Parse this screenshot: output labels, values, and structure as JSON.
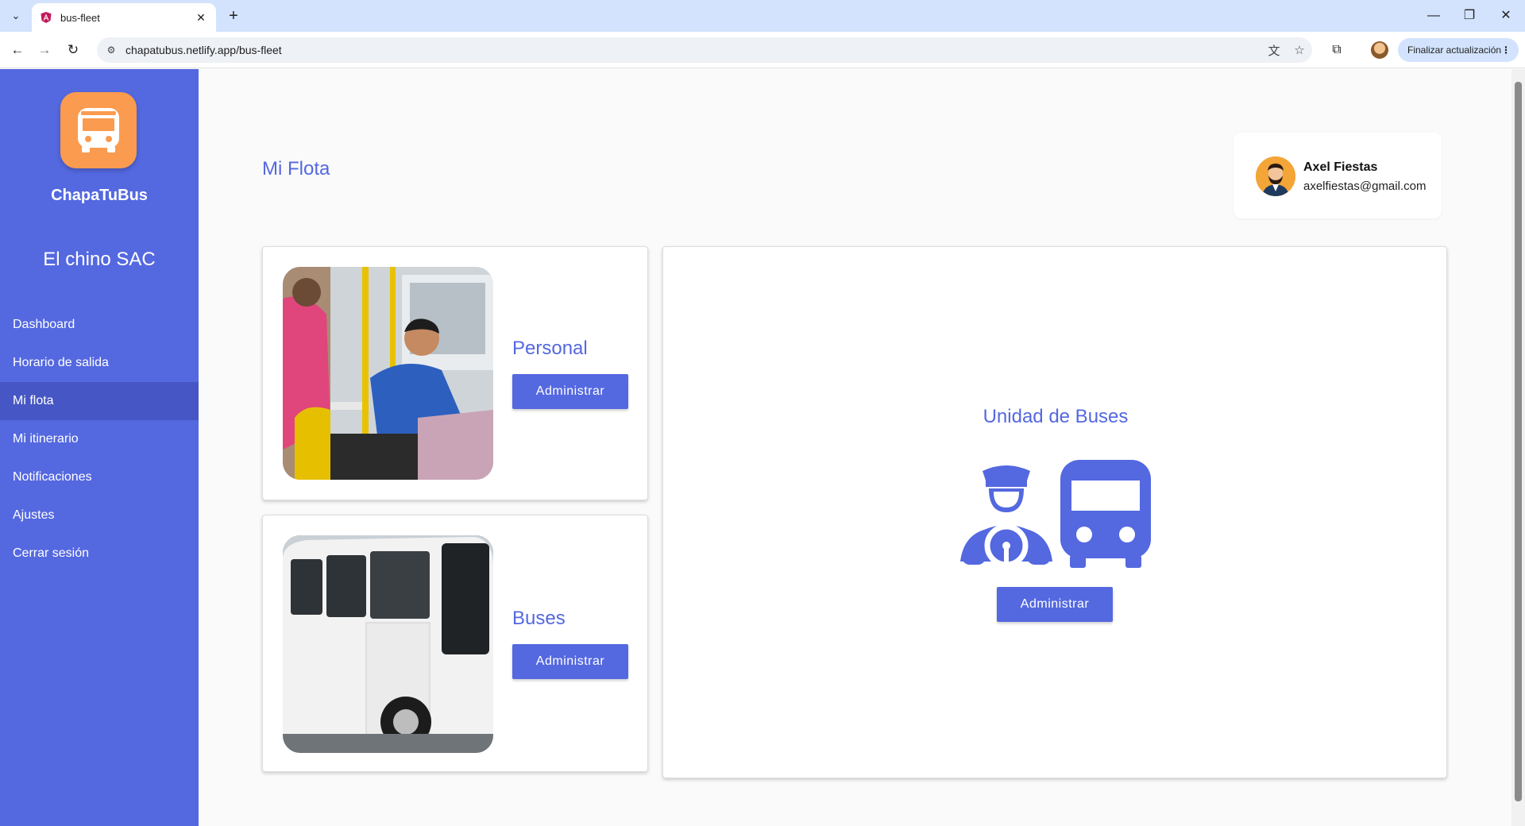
{
  "browser": {
    "tab_title": "bus-fleet",
    "url": "chapatubus.netlify.app/bus-fleet",
    "update_button": "Finalizar actualización"
  },
  "sidebar": {
    "brand": "ChapaTuBus",
    "company": "El chino SAC",
    "items": [
      {
        "label": "Dashboard"
      },
      {
        "label": "Horario de salida"
      },
      {
        "label": "Mi flota",
        "active": true
      },
      {
        "label": "Mi itinerario"
      },
      {
        "label": "Notificaciones"
      },
      {
        "label": "Ajustes"
      },
      {
        "label": "Cerrar sesión"
      }
    ]
  },
  "page": {
    "title": "Mi Flota"
  },
  "user": {
    "name": "Axel Fiestas",
    "email": "axelfiestas@gmail.com"
  },
  "cards": {
    "personal": {
      "label": "Personal",
      "button": "Administrar"
    },
    "buses": {
      "label": "Buses",
      "button": "Administrar"
    },
    "unidad": {
      "label": "Unidad de Buses",
      "button": "Administrar"
    }
  },
  "colors": {
    "primary": "#5468e0",
    "logo": "#fb9b4f",
    "tabstrip": "#d3e3fd"
  }
}
